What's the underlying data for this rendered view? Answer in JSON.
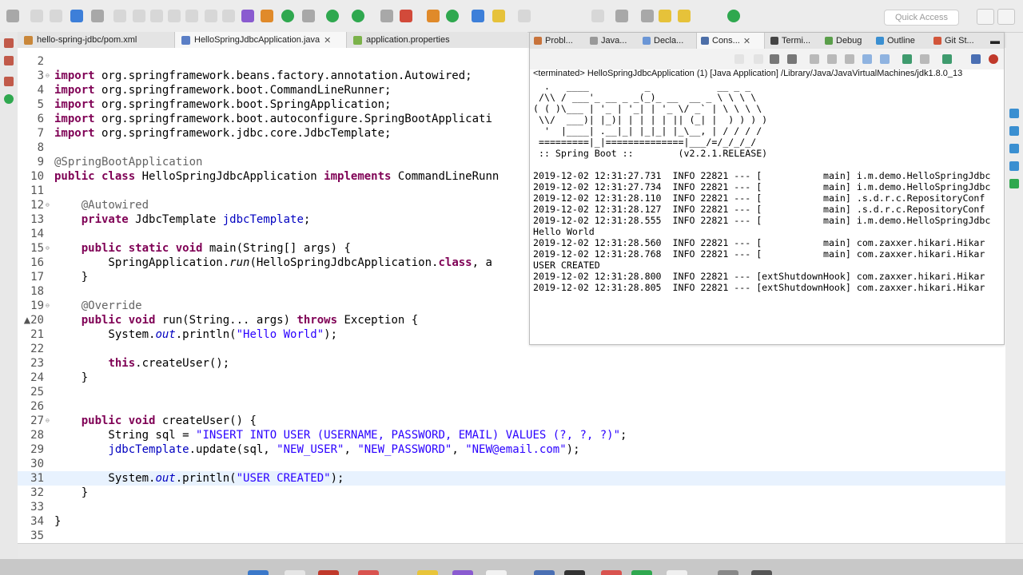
{
  "toolbar": {
    "quick_access_placeholder": "Quick Access"
  },
  "editor": {
    "tabs": [
      {
        "label": "hello-spring-jdbc/pom.xml",
        "active": false
      },
      {
        "label": "HelloSpringJdbcApplication.java",
        "active": true
      },
      {
        "label": "application.properties",
        "active": false
      }
    ],
    "lines": [
      {
        "n": "2",
        "segments": []
      },
      {
        "n": "3",
        "fold": "⊖",
        "segments": [
          {
            "t": "import",
            "c": "kw"
          },
          {
            "t": " org.springframework.beans.factory.annotation.Autowired;"
          }
        ]
      },
      {
        "n": "4",
        "segments": [
          {
            "t": "import",
            "c": "kw"
          },
          {
            "t": " org.springframework.boot.CommandLineRunner;"
          }
        ]
      },
      {
        "n": "5",
        "segments": [
          {
            "t": "import",
            "c": "kw"
          },
          {
            "t": " org.springframework.boot.SpringApplication;"
          }
        ]
      },
      {
        "n": "6",
        "segments": [
          {
            "t": "import",
            "c": "kw"
          },
          {
            "t": " org.springframework.boot.autoconfigure.SpringBootApplicati"
          }
        ]
      },
      {
        "n": "7",
        "segments": [
          {
            "t": "import",
            "c": "kw"
          },
          {
            "t": " org.springframework.jdbc.core.JdbcTemplate;"
          }
        ]
      },
      {
        "n": "8",
        "segments": []
      },
      {
        "n": "9",
        "segments": [
          {
            "t": "@SpringBootApplication",
            "c": "ann"
          }
        ]
      },
      {
        "n": "10",
        "segments": [
          {
            "t": "public class",
            "c": "kw"
          },
          {
            "t": " HelloSpringJdbcApplication "
          },
          {
            "t": "implements",
            "c": "kw"
          },
          {
            "t": " CommandLineRunn"
          }
        ]
      },
      {
        "n": "11",
        "segments": []
      },
      {
        "n": "12",
        "fold": "⊖",
        "segments": [
          {
            "t": "    "
          },
          {
            "t": "@Autowired",
            "c": "ann"
          }
        ]
      },
      {
        "n": "13",
        "segments": [
          {
            "t": "    "
          },
          {
            "t": "private",
            "c": "kw"
          },
          {
            "t": " JdbcTemplate "
          },
          {
            "t": "jdbcTemplate",
            "c": "fld"
          },
          {
            "t": ";"
          }
        ]
      },
      {
        "n": "14",
        "segments": []
      },
      {
        "n": "15",
        "fold": "⊖",
        "segments": [
          {
            "t": "    "
          },
          {
            "t": "public static void",
            "c": "kw"
          },
          {
            "t": " main(String[] args) {"
          }
        ]
      },
      {
        "n": "16",
        "segments": [
          {
            "t": "        SpringApplication."
          },
          {
            "t": "run",
            "c": "mstat"
          },
          {
            "t": "(HelloSpringJdbcApplication."
          },
          {
            "t": "class",
            "c": "kw"
          },
          {
            "t": ", a"
          }
        ]
      },
      {
        "n": "17",
        "segments": [
          {
            "t": "    }"
          }
        ]
      },
      {
        "n": "18",
        "segments": []
      },
      {
        "n": "19",
        "fold": "⊖",
        "segments": [
          {
            "t": "    "
          },
          {
            "t": "@Override",
            "c": "ann"
          }
        ]
      },
      {
        "n": "▲20",
        "segments": [
          {
            "t": "    "
          },
          {
            "t": "public void",
            "c": "kw"
          },
          {
            "t": " run(String... args) "
          },
          {
            "t": "throws",
            "c": "kw"
          },
          {
            "t": " Exception {"
          }
        ]
      },
      {
        "n": "21",
        "segments": [
          {
            "t": "        System."
          },
          {
            "t": "out",
            "c": "stat"
          },
          {
            "t": ".println("
          },
          {
            "t": "\"Hello World\"",
            "c": "str"
          },
          {
            "t": ");"
          }
        ]
      },
      {
        "n": "22",
        "segments": []
      },
      {
        "n": "23",
        "segments": [
          {
            "t": "        "
          },
          {
            "t": "this",
            "c": "kw"
          },
          {
            "t": ".createUser();"
          }
        ]
      },
      {
        "n": "24",
        "segments": [
          {
            "t": "    }"
          }
        ]
      },
      {
        "n": "25",
        "segments": []
      },
      {
        "n": "26",
        "segments": []
      },
      {
        "n": "27",
        "fold": "⊖",
        "segments": [
          {
            "t": "    "
          },
          {
            "t": "public void",
            "c": "kw"
          },
          {
            "t": " createUser() {"
          }
        ]
      },
      {
        "n": "28",
        "segments": [
          {
            "t": "        String sql = "
          },
          {
            "t": "\"INSERT INTO USER (USERNAME, PASSWORD, EMAIL) VALUES (?, ?, ?)\"",
            "c": "str"
          },
          {
            "t": ";"
          }
        ]
      },
      {
        "n": "29",
        "segments": [
          {
            "t": "        "
          },
          {
            "t": "jdbcTemplate",
            "c": "fld"
          },
          {
            "t": ".update(sql, "
          },
          {
            "t": "\"NEW_USER\"",
            "c": "str"
          },
          {
            "t": ", "
          },
          {
            "t": "\"NEW_PASSWORD\"",
            "c": "str"
          },
          {
            "t": ", "
          },
          {
            "t": "\"NEW@email.com\"",
            "c": "str"
          },
          {
            "t": ");"
          }
        ]
      },
      {
        "n": "30",
        "segments": []
      },
      {
        "n": "31",
        "current": true,
        "segments": [
          {
            "t": "        System."
          },
          {
            "t": "out",
            "c": "stat"
          },
          {
            "t": ".println("
          },
          {
            "t": "\"USER CREATED\"",
            "c": "str"
          },
          {
            "t": ");"
          }
        ]
      },
      {
        "n": "32",
        "segments": [
          {
            "t": "    }"
          }
        ]
      },
      {
        "n": "33",
        "segments": []
      },
      {
        "n": "34",
        "segments": [
          {
            "t": "}"
          }
        ]
      },
      {
        "n": "35",
        "segments": []
      }
    ]
  },
  "console": {
    "tabs": [
      {
        "label": "Probl...",
        "active": false
      },
      {
        "label": "Java...",
        "active": false
      },
      {
        "label": "Decla...",
        "active": false
      },
      {
        "label": "Cons...",
        "active": true
      },
      {
        "label": "Termi...",
        "active": false
      },
      {
        "label": "Debug",
        "active": false
      },
      {
        "label": "Outline",
        "active": false
      },
      {
        "label": "Git St...",
        "active": false
      }
    ],
    "status": "<terminated> HelloSpringJdbcApplication (1) [Java Application] /Library/Java/JavaVirtualMachines/jdk1.8.0_13",
    "lines": [
      "  .   ____          _            __ _ _",
      " /\\\\ / ___'_ __ _ _(_)_ __  __ _ \\ \\ \\ \\",
      "( ( )\\___ | '_ | '_| | '_ \\/ _` | \\ \\ \\ \\",
      " \\\\/  ___)| |_)| | | | | || (_| |  ) ) ) )",
      "  '  |____| .__|_| |_|_| |_\\__, | / / / /",
      " =========|_|==============|___/=/_/_/_/",
      " :: Spring Boot ::        (v2.2.1.RELEASE)",
      "",
      "2019-12-02 12:31:27.731  INFO 22821 --- [           main] i.m.demo.HelloSpringJdbc",
      "2019-12-02 12:31:27.734  INFO 22821 --- [           main] i.m.demo.HelloSpringJdbc",
      "2019-12-02 12:31:28.110  INFO 22821 --- [           main] .s.d.r.c.RepositoryConf",
      "2019-12-02 12:31:28.127  INFO 22821 --- [           main] .s.d.r.c.RepositoryConf",
      "2019-12-02 12:31:28.555  INFO 22821 --- [           main] i.m.demo.HelloSpringJdbc",
      "Hello World",
      "2019-12-02 12:31:28.560  INFO 22821 --- [           main] com.zaxxer.hikari.Hikar",
      "2019-12-02 12:31:28.768  INFO 22821 --- [           main] com.zaxxer.hikari.Hikar",
      "USER CREATED",
      "2019-12-02 12:31:28.800  INFO 22821 --- [extShutdownHook] com.zaxxer.hikari.Hikar",
      "2019-12-02 12:31:28.805  INFO 22821 --- [extShutdownHook] com.zaxxer.hikari.Hikar"
    ]
  }
}
